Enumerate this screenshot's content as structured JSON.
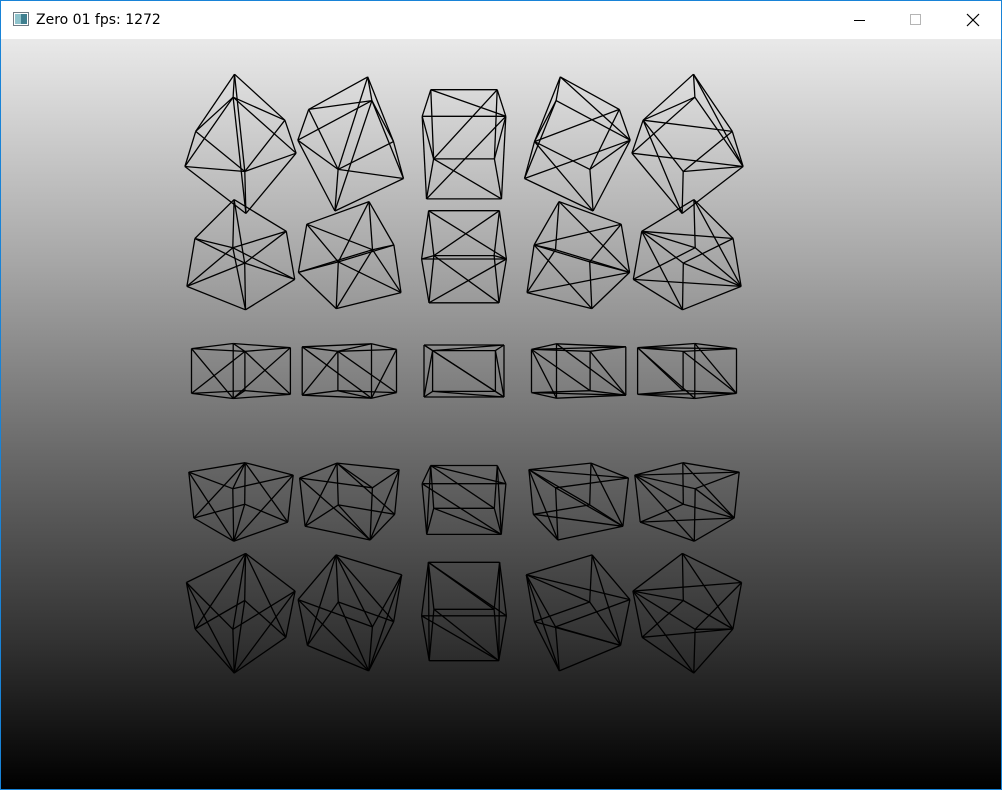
{
  "window": {
    "title": "Zero 01 fps: 1272",
    "accent_color": "#1883d7"
  },
  "icons": {
    "app": "app-window-icon",
    "minimize": "minimize-icon",
    "maximize": "maximize-icon",
    "close": "close-icon"
  },
  "scene": {
    "background_top": "#e9e9e9",
    "background_bottom": "#000000",
    "wireframe_color": "#000000",
    "grid_rows": 5,
    "grid_cols": 5
  }
}
